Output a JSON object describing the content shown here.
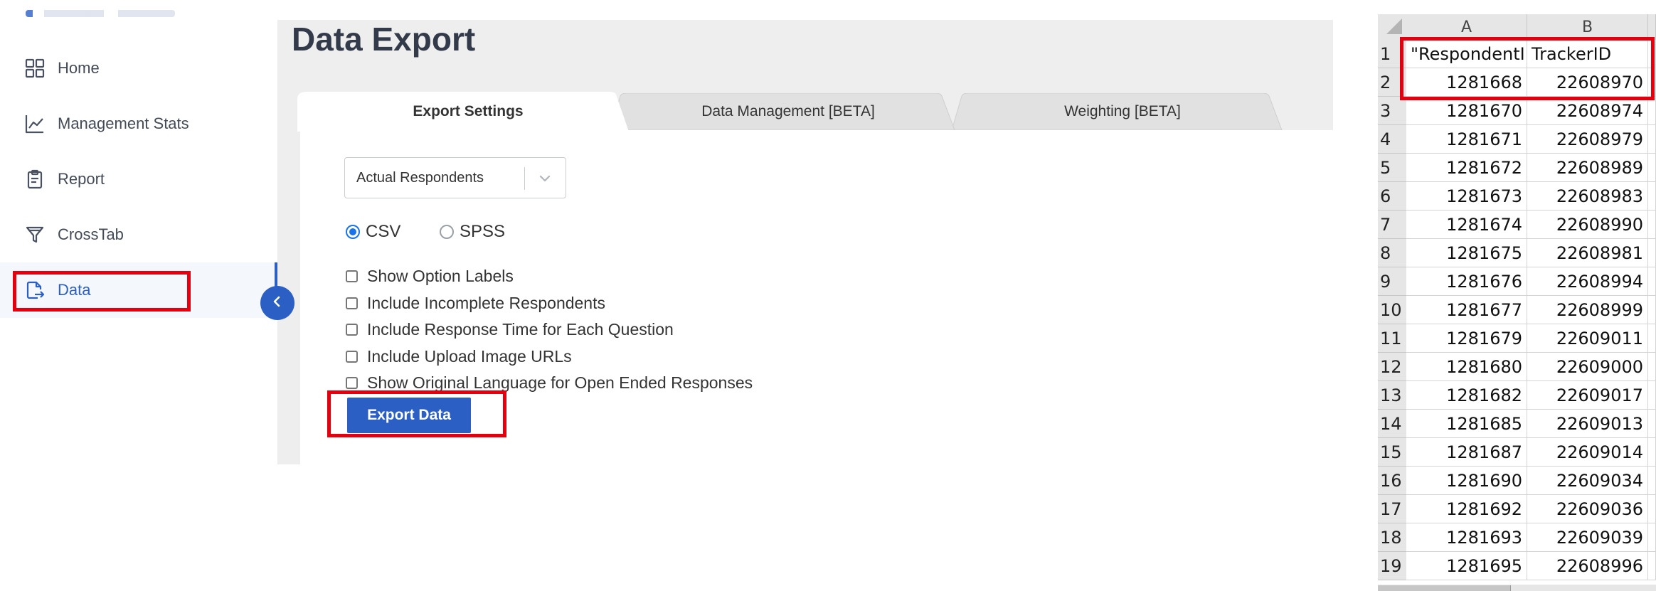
{
  "sidebar": {
    "items": [
      {
        "label": "Home",
        "icon": "grid-icon"
      },
      {
        "label": "Management Stats",
        "icon": "line-chart-icon"
      },
      {
        "label": "Report",
        "icon": "clipboard-icon"
      },
      {
        "label": "CrossTab",
        "icon": "filter-icon"
      },
      {
        "label": "Data",
        "icon": "file-export-icon",
        "active": true
      }
    ]
  },
  "main": {
    "title": "Data Export",
    "tabs": [
      {
        "label": "Export Settings",
        "active": true
      },
      {
        "label": "Data Management [BETA]"
      },
      {
        "label": "Weighting [BETA]"
      }
    ],
    "respondent_select": {
      "value": "Actual Respondents"
    },
    "format_options": [
      {
        "label": "CSV",
        "checked": true
      },
      {
        "label": "SPSS",
        "checked": false
      }
    ],
    "checkboxes": [
      {
        "label": "Show Option Labels",
        "checked": false
      },
      {
        "label": "Include Incomplete Respondents",
        "checked": false
      },
      {
        "label": "Include Response Time for Each Question",
        "checked": false
      },
      {
        "label": "Include Upload Image URLs",
        "checked": false
      },
      {
        "label": "Show Original Language for Open Ended Responses",
        "checked": false
      }
    ],
    "export_button": "Export Data"
  },
  "spreadsheet": {
    "columns": [
      "A",
      "B"
    ],
    "rows": [
      {
        "n": "1",
        "a": "\"RespondentID\"",
        "b": "TrackerID"
      },
      {
        "n": "2",
        "a": "1281668",
        "b": "22608970"
      },
      {
        "n": "3",
        "a": "1281670",
        "b": "22608974"
      },
      {
        "n": "4",
        "a": "1281671",
        "b": "22608979"
      },
      {
        "n": "5",
        "a": "1281672",
        "b": "22608989"
      },
      {
        "n": "6",
        "a": "1281673",
        "b": "22608983"
      },
      {
        "n": "7",
        "a": "1281674",
        "b": "22608990"
      },
      {
        "n": "8",
        "a": "1281675",
        "b": "22608981"
      },
      {
        "n": "9",
        "a": "1281676",
        "b": "22608994"
      },
      {
        "n": "10",
        "a": "1281677",
        "b": "22608999"
      },
      {
        "n": "11",
        "a": "1281679",
        "b": "22609011"
      },
      {
        "n": "12",
        "a": "1281680",
        "b": "22609000"
      },
      {
        "n": "13",
        "a": "1281682",
        "b": "22609017"
      },
      {
        "n": "14",
        "a": "1281685",
        "b": "22609013"
      },
      {
        "n": "15",
        "a": "1281687",
        "b": "22609014"
      },
      {
        "n": "16",
        "a": "1281690",
        "b": "22609034"
      },
      {
        "n": "17",
        "a": "1281692",
        "b": "22609036"
      },
      {
        "n": "18",
        "a": "1281693",
        "b": "22609039"
      },
      {
        "n": "19",
        "a": "1281695",
        "b": "22608996"
      }
    ]
  },
  "colors": {
    "accent": "#2b5fc4",
    "highlight": "#e3000f",
    "radio_checked": "#1a73e8"
  }
}
